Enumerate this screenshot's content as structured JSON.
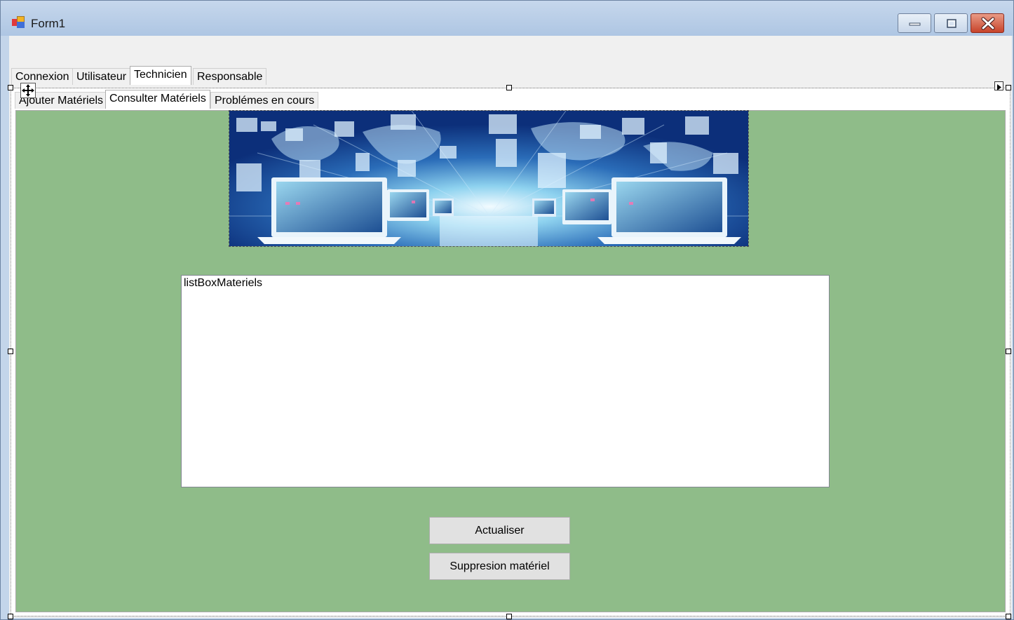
{
  "window": {
    "title": "Form1",
    "controls": [
      "minimize-icon",
      "maximize-icon",
      "close-icon"
    ]
  },
  "main_tabs": [
    {
      "label": "Connexion",
      "active": false
    },
    {
      "label": "Utilisateur",
      "active": false
    },
    {
      "label": "Technicien",
      "active": true
    },
    {
      "label": "Responsable",
      "active": false
    }
  ],
  "sub_tabs": [
    {
      "label": "Ajouter Matériels",
      "active": false
    },
    {
      "label": "Consulter Matériels",
      "active": true
    },
    {
      "label": "Problémes en cours",
      "active": false
    }
  ],
  "content": {
    "listbox_label": "listBoxMateriels",
    "refresh_button": "Actualiser",
    "delete_button": "Suppresion matériel",
    "background_color": "#8fbc89"
  }
}
